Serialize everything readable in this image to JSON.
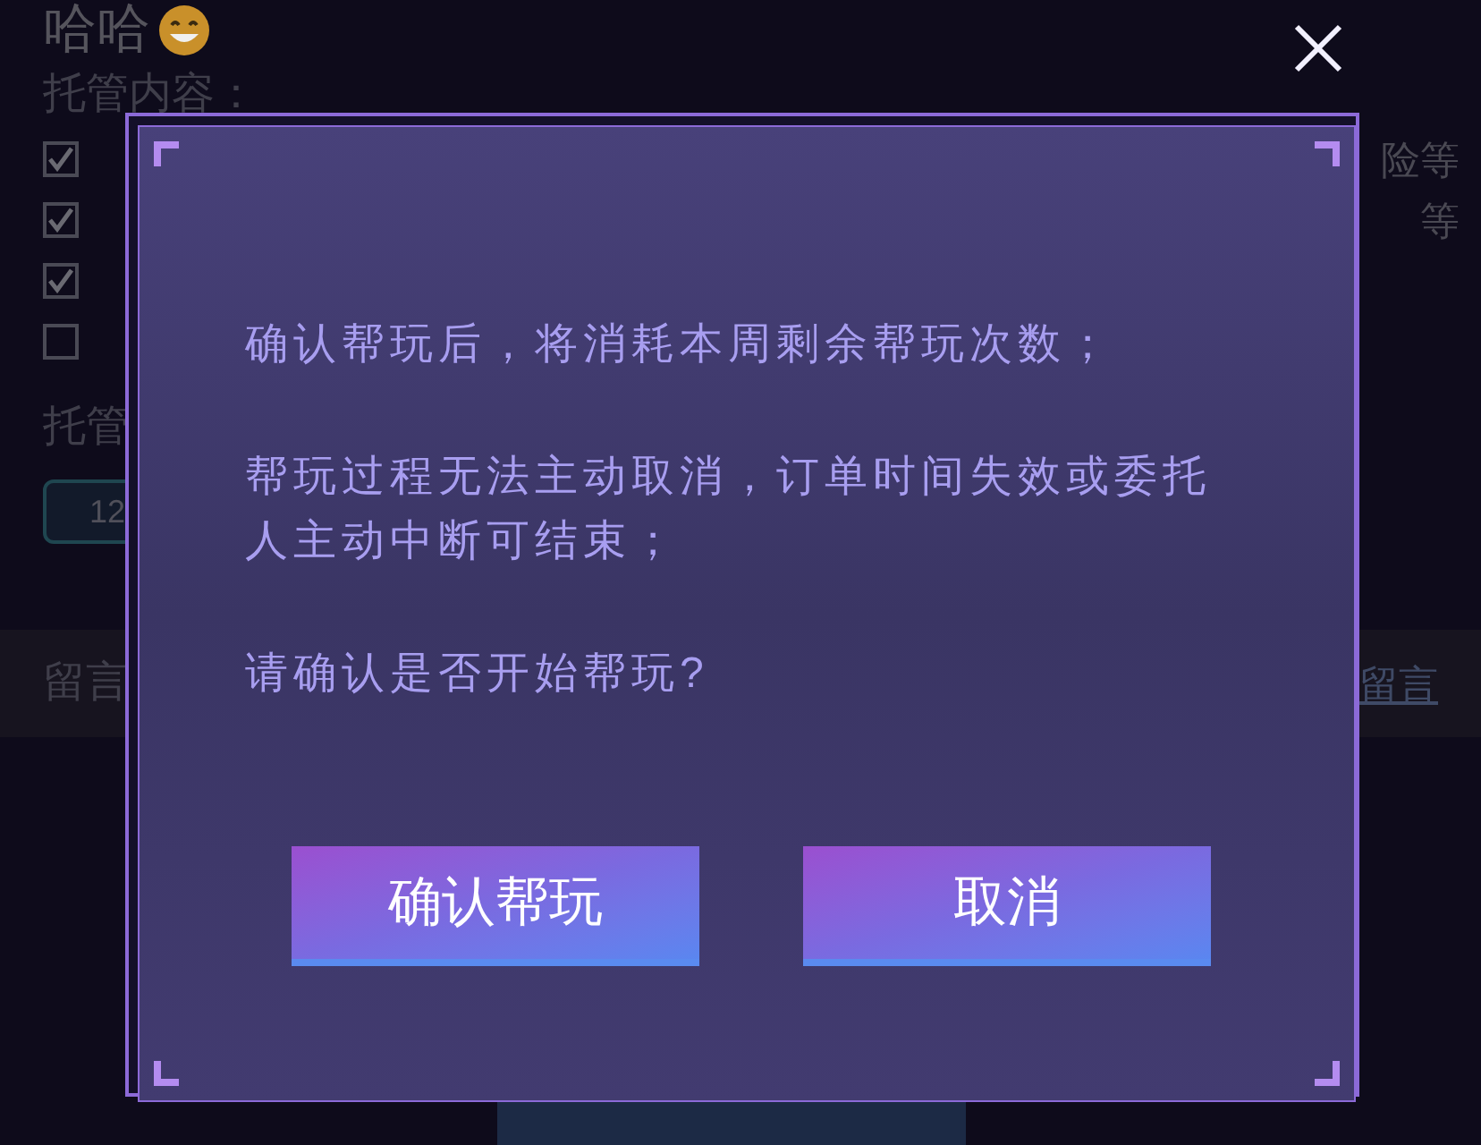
{
  "title": {
    "text": "哈哈"
  },
  "section_label": "托管内容：",
  "options": [
    {
      "checked": true,
      "note": "险等"
    },
    {
      "checked": true,
      "note": "等"
    },
    {
      "checked": true
    },
    {
      "checked": false
    }
  ],
  "duration_label": "托管",
  "duration_field": {
    "value": "12"
  },
  "message": {
    "label": "留言",
    "link": "留言"
  },
  "dialog": {
    "paragraphs": [
      "确认帮玩后，将消耗本周剩余帮玩次数；",
      "帮玩过程无法主动取消，订单时间失效或委托人主动中断可结束；",
      "请确认是否开始帮玩?"
    ],
    "buttons": [
      "确认帮玩",
      "取消"
    ]
  }
}
